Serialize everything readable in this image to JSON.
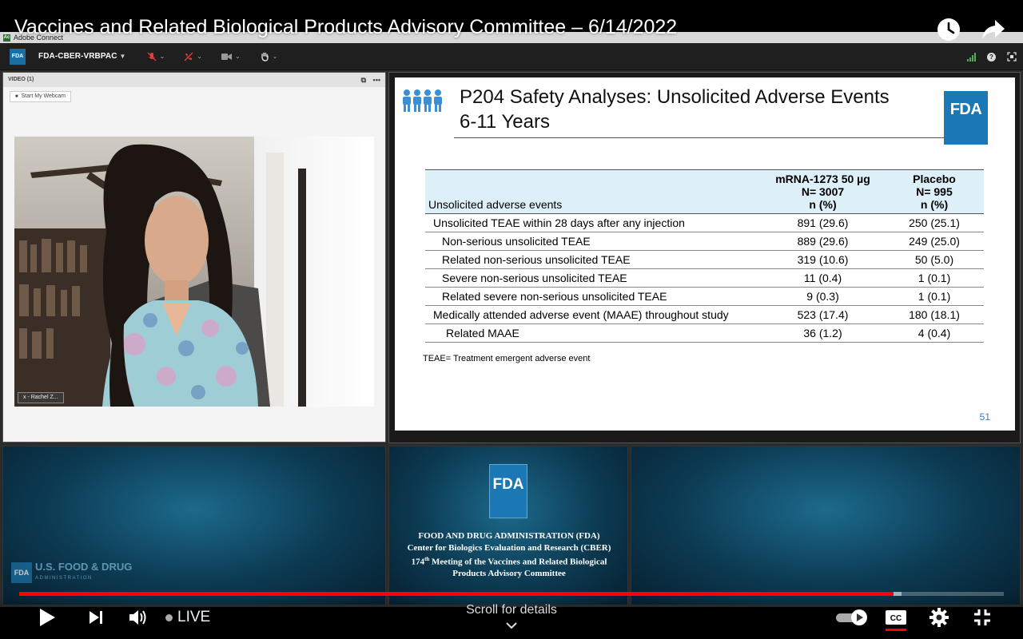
{
  "youtube": {
    "video_title": "Vaccines and Related Biological Products Advisory Committee – 6/14/2022",
    "live_label": "LIVE",
    "scroll_hint": "Scroll for details",
    "progress": {
      "played_fraction": 0.888,
      "loaded_fraction": 0.896
    },
    "icons": {
      "watch_later": "clock-icon",
      "share": "share-arrow-icon",
      "play": "play-icon",
      "next": "next-icon",
      "volume": "volume-icon",
      "autoplay": "autoplay-toggle-icon",
      "captions": "cc-icon",
      "settings": "gear-icon",
      "fullscreen": "fullscreen-icon",
      "scroll": "chevron-down-icon"
    }
  },
  "adobe_connect": {
    "window_title": "Adobe Connect",
    "logo_text": "FDA",
    "room_name": "FDA-CBER-VRBPAC",
    "video_pod": {
      "header": "VIDEO (1)",
      "start_webcam": "Start My Webcam",
      "participant_name": "x - Rachel Z..."
    },
    "colors": {
      "brand_blue": "#1b78b5",
      "bar_red": "#ff0000"
    }
  },
  "slide": {
    "title_line1": "P204 Safety Analyses: Unsolicited Adverse Events",
    "title_line2": "6-11 Years",
    "logo": "FDA",
    "table": {
      "header_label": "Unsolicited adverse events",
      "col1": {
        "line1": "mRNA-1273 50 µg",
        "line2": "N= 3007",
        "line3": "n (%)"
      },
      "col2": {
        "line1": "Placebo",
        "line2": "N= 995",
        "line3": "n (%)"
      },
      "rows": [
        {
          "label": "Unsolicited TEAE within 28 days after any injection",
          "v1": "891 (29.6)",
          "v2": "250 (25.1)"
        },
        {
          "label": "Non-serious unsolicited TEAE",
          "v1": "889 (29.6)",
          "v2": "249 (25.0)"
        },
        {
          "label": "Related non-serious unsolicited TEAE",
          "v1": "319 (10.6)",
          "v2": "50 (5.0)"
        },
        {
          "label": "Severe non-serious unsolicited TEAE",
          "v1": "11 (0.4)",
          "v2": "1 (0.1)"
        },
        {
          "label": "Related severe non-serious unsolicited TEAE",
          "v1": "9 (0.3)",
          "v2": "1 (0.1)"
        },
        {
          "label": "Medically attended adverse event (MAAE) throughout study",
          "v1": "523 (17.4)",
          "v2": "180 (18.1)"
        },
        {
          "label": "Related MAAE",
          "v1": "36 (1.2)",
          "v2": "4 (0.4)"
        }
      ]
    },
    "footnote": "TEAE= Treatment emergent adverse event",
    "page_number": "51"
  },
  "brand": {
    "left_logo": "FDA",
    "left_line1": "U.S. FOOD & DRUG",
    "left_line2": "ADMINISTRATION",
    "center_logo": "FDA",
    "center_line1": "FOOD AND DRUG ADMINISTRATION (FDA)",
    "center_line2": "Center for Biologics Evaluation and Research (CBER)",
    "center_line3_num": "174",
    "center_line3_sup": "th",
    "center_line3_rest": " Meeting of the Vaccines and Related Biological",
    "center_line4": "Products Advisory Committee"
  }
}
